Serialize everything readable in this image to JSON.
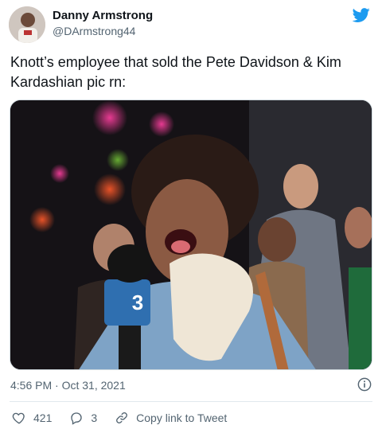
{
  "author": {
    "name": "Danny Armstrong",
    "handle": "@DArmstrong44"
  },
  "tweet": {
    "text": "Knott’s employee that sold the Pete Davidson & Kim Kardashian pic rn:"
  },
  "media": {
    "mic_flag_label": "3"
  },
  "meta": {
    "timestamp": "4:56 PM · Oct 31, 2021"
  },
  "actions": {
    "likes": "421",
    "replies": "3",
    "copy_link": "Copy link to Tweet"
  },
  "colors": {
    "twitter_blue": "#1d9bf0",
    "like_red": "#e0245e",
    "text_secondary": "#536471"
  }
}
